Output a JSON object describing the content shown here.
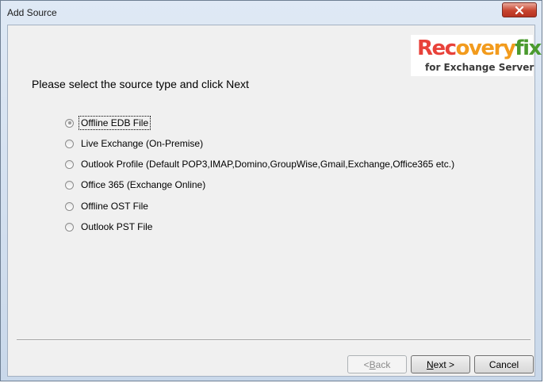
{
  "window": {
    "title": "Add Source",
    "close_icon": "close-x-icon"
  },
  "logo": {
    "word_parts": [
      {
        "text": "Rec",
        "color": "#e8423a"
      },
      {
        "text": "overy",
        "color": "#f29b1d"
      },
      {
        "text": "fix",
        "color": "#4a9a2e"
      }
    ],
    "subtitle": "for Exchange Server"
  },
  "instruction": "Please select the source type and click Next",
  "options": [
    {
      "label": "Offline EDB File",
      "checked": true,
      "focused": true
    },
    {
      "label": "Live Exchange (On-Premise)",
      "checked": false
    },
    {
      "label": "Outlook Profile (Default POP3,IMAP,Domino,GroupWise,Gmail,Exchange,Office365 etc.)",
      "checked": false
    },
    {
      "label": "Office 365 (Exchange Online)",
      "checked": false
    },
    {
      "label": "Offline OST File",
      "checked": false
    },
    {
      "label": "Outlook PST File",
      "checked": false
    }
  ],
  "buttons": {
    "back": {
      "pre": "< ",
      "accel": "B",
      "post": "ack",
      "enabled": false
    },
    "next": {
      "pre": "",
      "accel": "N",
      "post": "ext >",
      "enabled": true
    },
    "cancel": {
      "label": "Cancel",
      "enabled": true
    }
  }
}
